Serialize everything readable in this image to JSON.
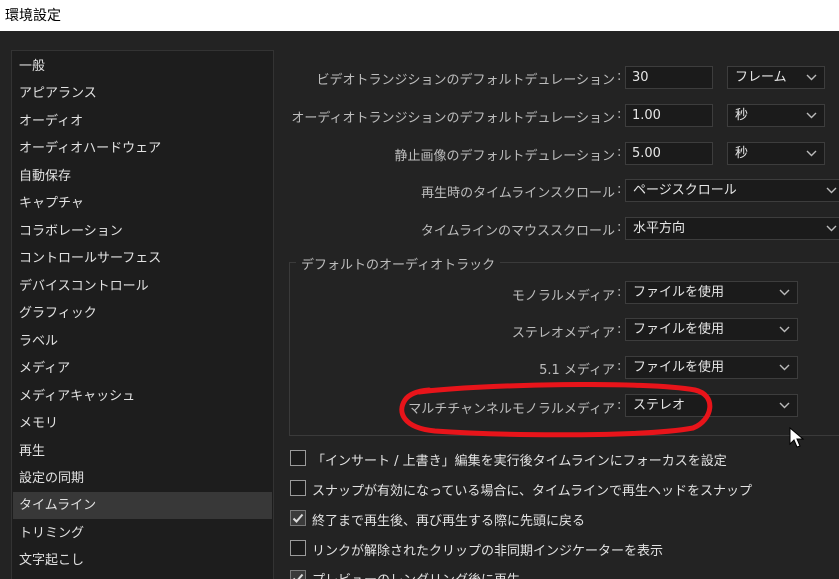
{
  "window": {
    "title": "環境設定"
  },
  "sidebar": {
    "items": [
      {
        "label": "一般"
      },
      {
        "label": "アピアランス"
      },
      {
        "label": "オーディオ"
      },
      {
        "label": "オーディオハードウェア"
      },
      {
        "label": "自動保存"
      },
      {
        "label": "キャプチャ"
      },
      {
        "label": "コラボレーション"
      },
      {
        "label": "コントロールサーフェス"
      },
      {
        "label": "デバイスコントロール"
      },
      {
        "label": "グラフィック"
      },
      {
        "label": "ラベル"
      },
      {
        "label": "メディア"
      },
      {
        "label": "メディアキャッシュ"
      },
      {
        "label": "メモリ"
      },
      {
        "label": "再生"
      },
      {
        "label": "設定の同期"
      },
      {
        "label": "タイムライン"
      },
      {
        "label": "トリミング"
      },
      {
        "label": "文字起こし"
      }
    ],
    "selected": "タイムライン"
  },
  "settings": {
    "video_transition": {
      "label": "ビデオトランジションのデフォルトデュレーション",
      "value": "30",
      "unit": "フレーム"
    },
    "audio_transition": {
      "label": "オーディオトランジションのデフォルトデュレーション",
      "value": "1.00",
      "unit": "秒"
    },
    "still_image": {
      "label": "静止画像のデフォルトデュレーション",
      "value": "5.00",
      "unit": "秒"
    },
    "playback_scroll": {
      "label": "再生時のタイムラインスクロール",
      "value": "ページスクロール"
    },
    "mouse_scroll": {
      "label": "タイムラインのマウススクロール",
      "value": "水平方向"
    }
  },
  "audio_tracks": {
    "group_title": "デフォルトのオーディオトラック",
    "mono": {
      "label": "モノラルメディア",
      "value": "ファイルを使用"
    },
    "stereo": {
      "label": "ステレオメディア",
      "value": "ファイルを使用"
    },
    "five_one": {
      "label": "5.1 メディア",
      "value": "ファイルを使用"
    },
    "multichannel_mono": {
      "label": "マルチチャンネルモノラルメディア",
      "value": "ステレオ"
    }
  },
  "colon": ":",
  "checkboxes": [
    {
      "label": "「インサート / 上書き」編集を実行後タイムラインにフォーカスを設定",
      "checked": false
    },
    {
      "label": "スナップが有効になっている場合に、タイムラインで再生ヘッドをスナップ",
      "checked": false
    },
    {
      "label": "終了まで再生後、再び再生する際に先頭に戻る",
      "checked": true
    },
    {
      "label": "リンクが解除されたクリップの非同期インジケーターを表示",
      "checked": false
    },
    {
      "label": "プレビューのレンダリング後に再生",
      "checked": true
    }
  ],
  "colors": {
    "annotation": "#e8141a",
    "background": "#232323",
    "panel": "#1d1d1d",
    "selected": "#383838"
  }
}
